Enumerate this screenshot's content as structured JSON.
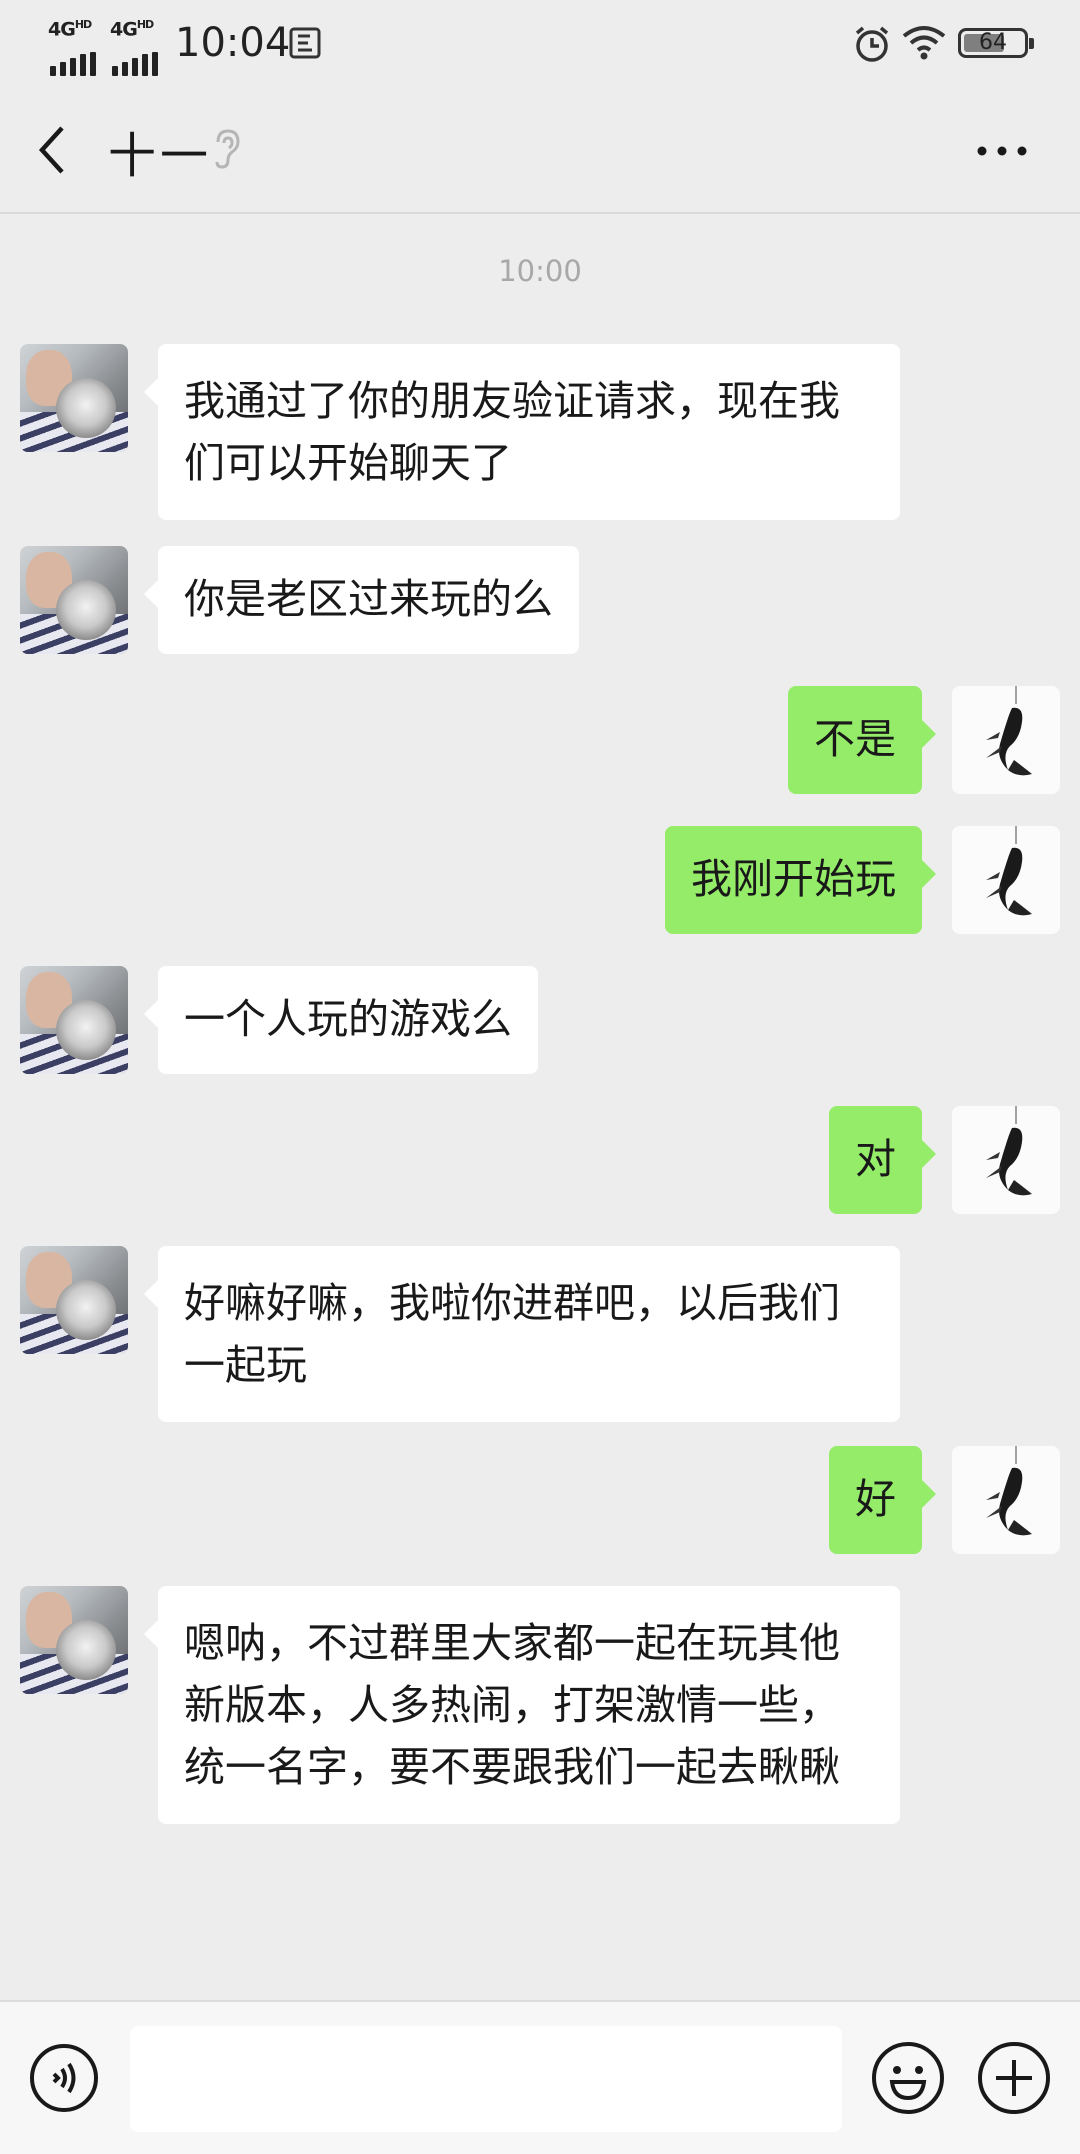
{
  "status_bar": {
    "signal1_label": "4G",
    "signal1_sup": "HD",
    "signal2_label": "4G",
    "signal2_sup": "HD",
    "time": "10:04",
    "battery_level": "64"
  },
  "header": {
    "title": "十一"
  },
  "chat": {
    "timestamp": "10:00",
    "messages": [
      {
        "side": "left",
        "text": "我通过了你的朋友验证请求，现在我们可以开始聊天了"
      },
      {
        "side": "left",
        "text": "你是老区过来玩的么"
      },
      {
        "side": "right",
        "text": "不是"
      },
      {
        "side": "right",
        "text": "我刚开始玩"
      },
      {
        "side": "left",
        "text": "一个人玩的游戏么"
      },
      {
        "side": "right",
        "text": "对"
      },
      {
        "side": "left",
        "text": "好嘛好嘛，我啦你进群吧，以后我们一起玩"
      },
      {
        "side": "right",
        "text": "好"
      },
      {
        "side": "left",
        "text": "嗯呐，不过群里大家都一起在玩其他新版本，人多热闹，打架激情一些，统一名字，要不要跟我们一起去瞅瞅"
      }
    ]
  },
  "input_bar": {
    "message_value": ""
  },
  "colors": {
    "background": "#ededed",
    "incoming_bubble": "#ffffff",
    "outgoing_bubble": "#95ec69",
    "timestamp_text": "#a8a8a8"
  },
  "icons": [
    "back-arrow-icon",
    "ear-icon",
    "more-dots-icon",
    "voice-icon",
    "emoji-icon",
    "plus-icon",
    "alarm-icon",
    "wifi-icon",
    "battery-icon",
    "screenshot-icon"
  ]
}
